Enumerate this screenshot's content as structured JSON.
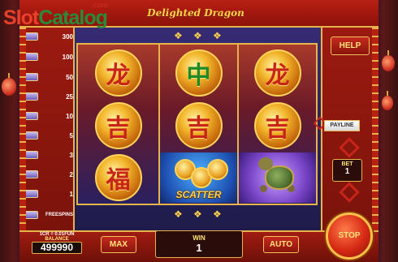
{
  "watermark": {
    "slot": "Slot",
    "catalog": "Catalog",
    "com": ".com"
  },
  "game": {
    "title": "Delighted Dragon"
  },
  "paytable": [
    {
      "value": "300"
    },
    {
      "value": "100"
    },
    {
      "value": "50"
    },
    {
      "value": "25"
    },
    {
      "value": "10"
    },
    {
      "value": "5"
    },
    {
      "value": "3"
    },
    {
      "value": "2"
    },
    {
      "value": "1"
    },
    {
      "value": "FREESPINS"
    }
  ],
  "reels": [
    [
      {
        "icon": "dragon-character-coin",
        "glyph": "龙",
        "color": "red"
      },
      {
        "icon": "fortune-character-coin",
        "glyph": "吉",
        "color": "red"
      },
      {
        "icon": "luck-character-coin",
        "glyph": "福",
        "color": "red"
      }
    ],
    [
      {
        "icon": "jade-character-coin",
        "glyph": "中",
        "color": "green"
      },
      {
        "icon": "fortune-character-coin",
        "glyph": "吉",
        "color": "red"
      },
      {
        "icon": "scatter-coins",
        "label": "SCATTER"
      }
    ],
    [
      {
        "icon": "dragon-character-coin",
        "glyph": "龙",
        "color": "red"
      },
      {
        "icon": "fortune-character-coin",
        "glyph": "吉",
        "color": "red"
      },
      {
        "icon": "turtle-symbol"
      }
    ]
  ],
  "controls": {
    "help": "HELP",
    "payline": "PAYLINE",
    "bet_label": "BET",
    "bet_value": "1",
    "rate": "1CR = 0.01FUN",
    "balance_label": "BALANCE",
    "balance_value": "499990",
    "max": "MAX",
    "win_label": "WIN",
    "win_value": "1",
    "auto": "AUTO",
    "stop": "STOP"
  },
  "colors": {
    "frame_red": "#b81f14",
    "gold": "#e6b34d",
    "accent_yellow": "#ffe27a"
  }
}
